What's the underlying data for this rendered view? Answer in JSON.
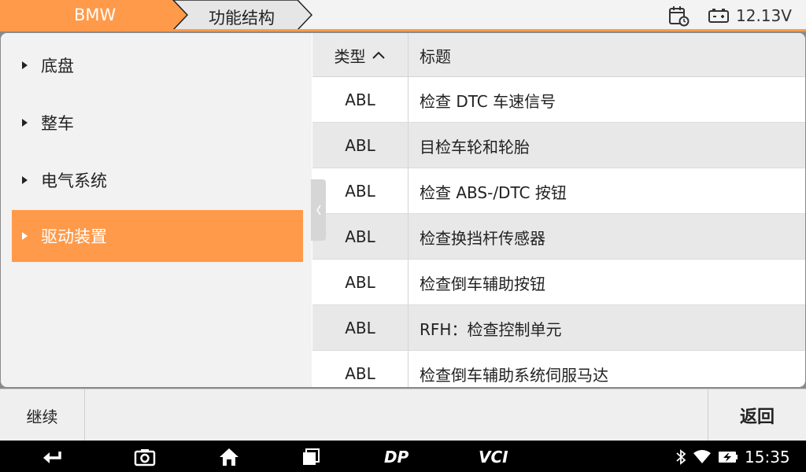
{
  "breadcrumb": {
    "brand": "BMW",
    "section": "功能结构"
  },
  "status": {
    "battery_voltage": "12.13V"
  },
  "menu": {
    "items": [
      {
        "label": "底盘",
        "active": false
      },
      {
        "label": "整车",
        "active": false
      },
      {
        "label": "电气系统",
        "active": false
      },
      {
        "label": "驱动装置",
        "active": true
      }
    ]
  },
  "table": {
    "headers": {
      "type": "类型",
      "title": "标题"
    },
    "rows": [
      {
        "type": "ABL",
        "title": "检查 DTC 车速信号"
      },
      {
        "type": "ABL",
        "title": "目检车轮和轮胎"
      },
      {
        "type": "ABL",
        "title": "检查 ABS-/DTC 按钮"
      },
      {
        "type": "ABL",
        "title": "检查换挡杆传感器"
      },
      {
        "type": "ABL",
        "title": "检查倒车辅助按钮"
      },
      {
        "type": "ABL",
        "title": "RFH：检查控制单元"
      },
      {
        "type": "ABL",
        "title": "检查倒车辅助系统伺服马达"
      }
    ]
  },
  "actions": {
    "continue": "继续",
    "back": "返回"
  },
  "navbar": {
    "dp_label": "DP",
    "vci_label": "VCI",
    "clock": "15:35"
  },
  "colors": {
    "accent": "#ff9a4a",
    "header_bg": "#eaeaea",
    "row_alt": "#e8e8e8"
  }
}
